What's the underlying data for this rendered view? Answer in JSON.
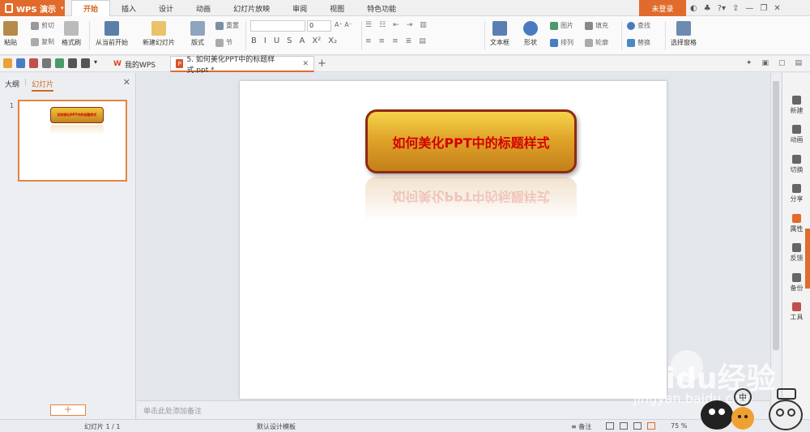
{
  "app": {
    "name": "WPS 演示",
    "login": "未登录"
  },
  "menu_tabs": [
    "开始",
    "插入",
    "设计",
    "动画",
    "幻灯片放映",
    "审阅",
    "视图",
    "特色功能"
  ],
  "ribbon": {
    "paste": "粘贴",
    "cut": "剪切",
    "copy": "复制",
    "format_painter": "格式刷",
    "play_from_current": "从当前开始",
    "new_slide": "新建幻灯片",
    "layout": "版式",
    "reset": "重置",
    "section": "节",
    "font_size": "0",
    "text_box": "文本框",
    "shape": "形状",
    "picture": "图片",
    "fill": "填充",
    "arrange": "排列",
    "outline": "轮廓",
    "find": "查找",
    "replace": "替换",
    "select_pane": "选择窗格"
  },
  "doc_tabs": [
    {
      "label": "我的WPS",
      "active": false
    },
    {
      "label": "5. 如何美化PPT中的标题样式.ppt *",
      "active": true
    }
  ],
  "left_panel": {
    "tab_outline": "大纲",
    "tab_slides": "幻灯片",
    "slide_number": "1"
  },
  "slide": {
    "title": "如何美化PPT中的标题样式"
  },
  "notes_placeholder": "单击此处添加备注",
  "right_panel": [
    "新建",
    "动画",
    "切换",
    "分享",
    "属性",
    "反馈",
    "备份",
    "工具"
  ],
  "status": {
    "slide_count": "幻灯片 1 / 1",
    "template": "默认设计模板",
    "notes": "备注",
    "zoom": "75 %"
  },
  "watermark": {
    "brand": "Baidu经验",
    "url": "jingyan.baidu.com"
  },
  "colors": {
    "accent": "#e06b2c",
    "title_red": "#d40000",
    "title_gold": "#e0a52a"
  }
}
